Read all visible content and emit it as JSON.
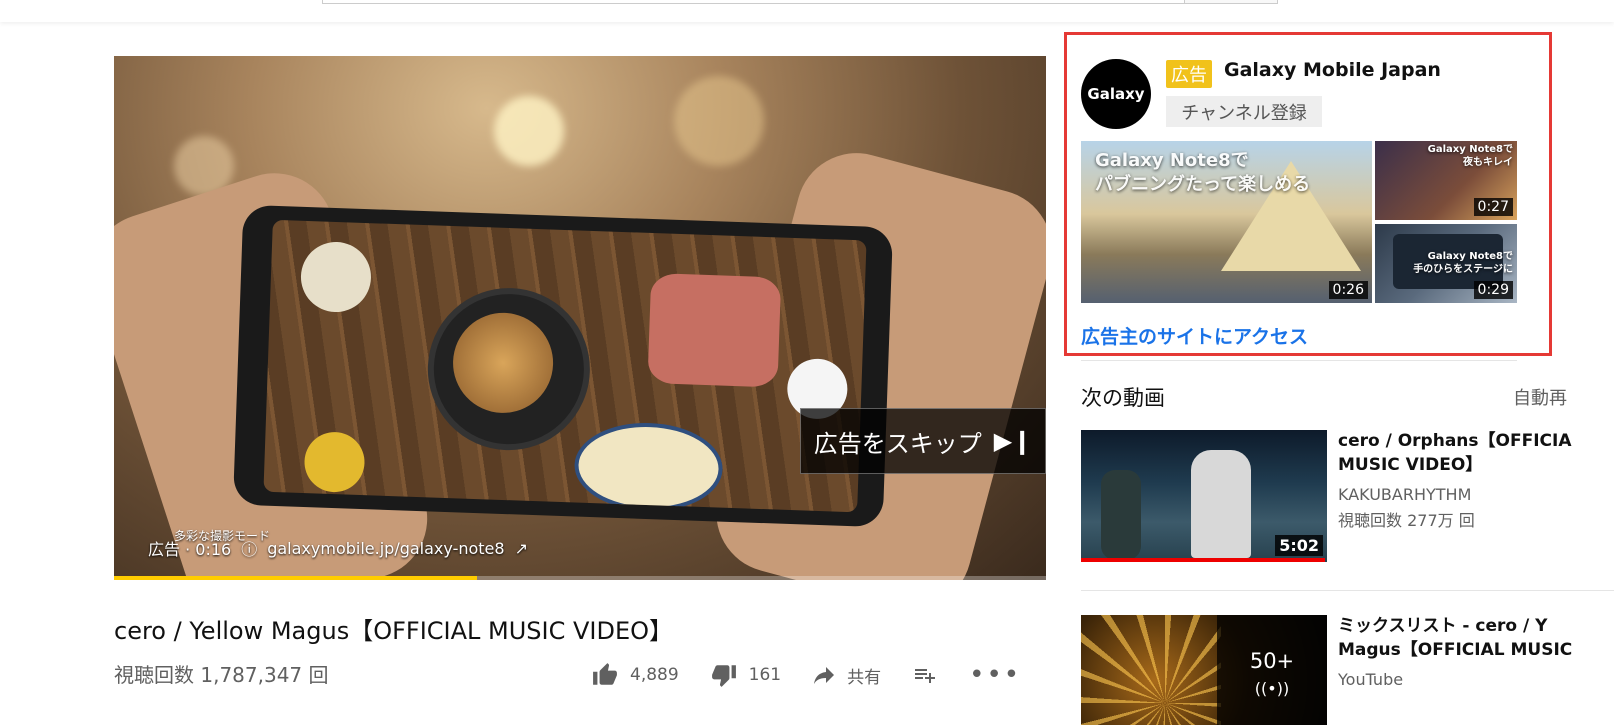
{
  "player": {
    "skip_label": "広告をスキップ",
    "ad_time": "広告 · 0:16",
    "ad_url": "galaxymobile.jp/galaxy-note8",
    "overlay_text": "多彩な撮影モード",
    "progress_fraction": 0.39
  },
  "video": {
    "title": "cero / Yellow Magus【OFFICIAL MUSIC VIDEO】",
    "views": "視聴回数 1,787,347 回",
    "likes": "4,889",
    "dislikes": "161",
    "share_label": "共有"
  },
  "ad": {
    "badge": "広告",
    "advertiser": "Galaxy Mobile Japan",
    "logo_text": "Galaxy",
    "subscribe_label": "チャンネル登録",
    "visit_label": "広告主のサイトにアクセス",
    "thumbs": [
      {
        "caption": "Galaxy Note8で\nパブニングたって楽しめる",
        "duration": "0:26"
      },
      {
        "caption": "Galaxy Note8で\n夜もキレイ",
        "duration": "0:27"
      },
      {
        "caption": "Galaxy Note8で\n手のひらをステージに",
        "duration": "0:29"
      }
    ],
    "highlight_color": "#e53935"
  },
  "sidebar": {
    "up_next": "次の動画",
    "autoplay": "自動再",
    "items": [
      {
        "title_line1": "cero / Orphans【OFFICIA",
        "title_line2": "MUSIC VIDEO】",
        "channel": "KAKUBARHYTHM",
        "views": "視聴回数 277万 回",
        "duration": "5:02"
      },
      {
        "title_line1": "ミックスリスト - cero / Y",
        "title_line2": "Magus【OFFICIAL MUSIC",
        "channel": "YouTube",
        "count": "50+"
      }
    ]
  }
}
